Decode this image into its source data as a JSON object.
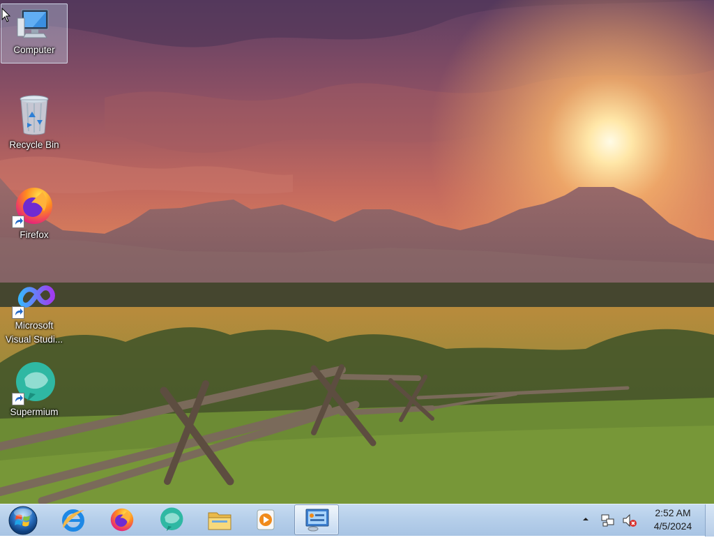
{
  "desktop": {
    "icons": [
      {
        "label": "Computer",
        "icon": "computer-icon",
        "selected": true
      },
      {
        "label": "Recycle Bin",
        "icon": "recycle-bin-icon"
      },
      {
        "label": "Firefox",
        "icon": "firefox-icon",
        "shortcut": true
      },
      {
        "label": "Microsoft Visual Studi...",
        "icon": "visual-studio-icon",
        "shortcut": true
      },
      {
        "label": "Supermium",
        "icon": "supermium-icon",
        "shortcut": true
      }
    ]
  },
  "taskbar": {
    "start": "start-orb-icon",
    "pinned": [
      {
        "name": "internet-explorer",
        "icon": "internet-explorer-icon"
      },
      {
        "name": "firefox",
        "icon": "firefox-icon"
      },
      {
        "name": "supermium",
        "icon": "supermium-icon"
      },
      {
        "name": "file-explorer",
        "icon": "folder-icon"
      },
      {
        "name": "media-player",
        "icon": "media-player-icon"
      },
      {
        "name": "control-panel",
        "icon": "control-panel-icon",
        "active": true
      }
    ],
    "tray": {
      "icons": [
        "show-hidden-icons-arrow",
        "network-icon",
        "volume-muted-icon"
      ],
      "time": "2:52 AM",
      "date": "4/5/2024"
    }
  },
  "colors": {
    "taskbar": "#b6cfea",
    "sky_top": "#6b4a6e",
    "sunset": "#f2a15c",
    "grass": "#6f8a34"
  }
}
